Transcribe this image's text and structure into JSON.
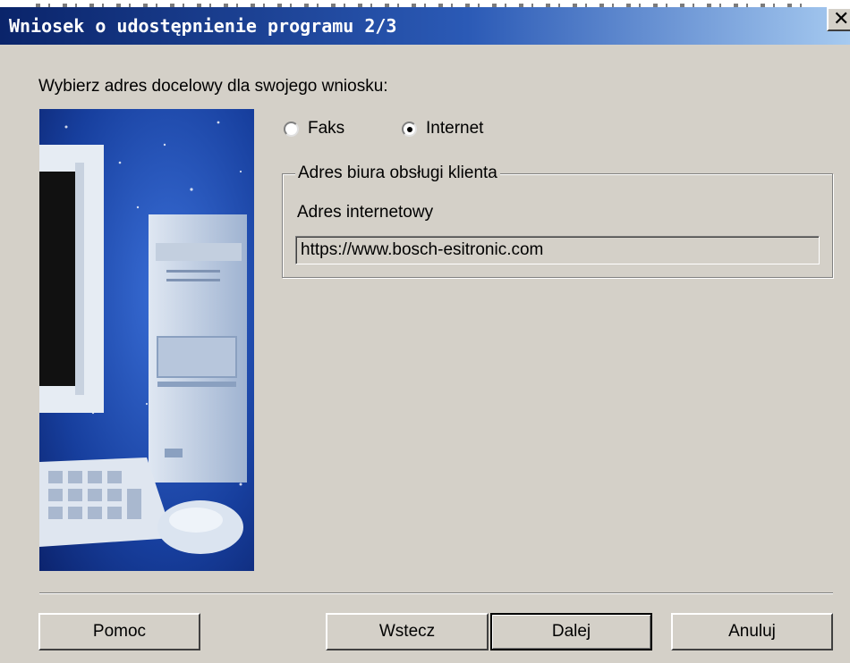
{
  "window": {
    "title": "Wniosek o udostępnienie programu 2/3",
    "close_symbol": "✕",
    "close_icon": "close-icon"
  },
  "prompt": "Wybierz adres docelowy dla swojego wniosku:",
  "options": {
    "fax_label": "Faks",
    "internet_label": "Internet",
    "selected": "Internet"
  },
  "group": {
    "title": "Adres biura obsługi klienta",
    "field_label": "Adres internetowy",
    "url": "https://www.bosch-esitronic.com"
  },
  "buttons": {
    "help": "Pomoc",
    "back": "Wstecz",
    "next": "Dalej",
    "cancel": "Anuluj"
  },
  "colors": {
    "titlebar_start": "#0a246a",
    "titlebar_end": "#a6caf0",
    "dialog_bg": "#d4d0c8"
  }
}
